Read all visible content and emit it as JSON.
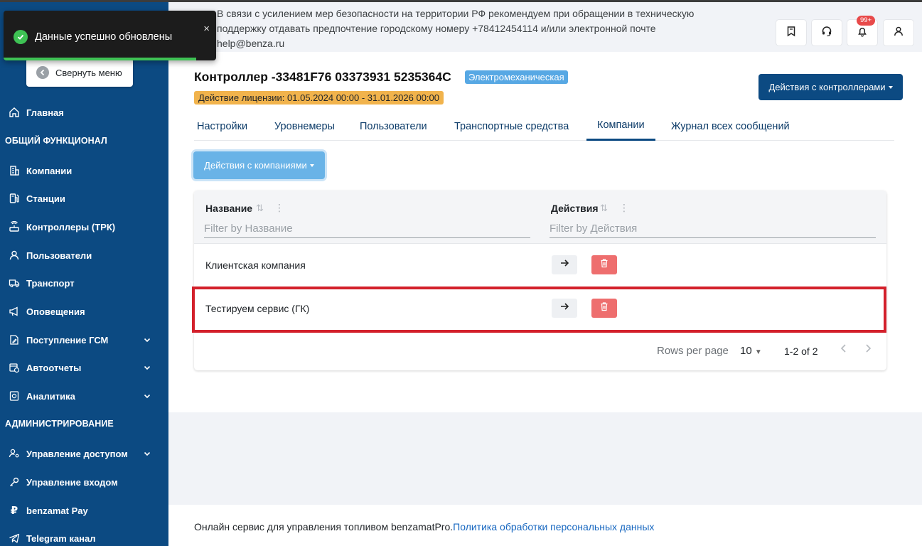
{
  "toast": {
    "message": "Данные успешно обновлены",
    "close": "×"
  },
  "sidebar": {
    "collapse_label": "Свернуть меню",
    "home": "Главная",
    "section_general": "ОБЩИЙ ФУНКЦИОНАЛ",
    "items": [
      "Компании",
      "Станции",
      "Контроллеры (ТРК)",
      "Пользователи",
      "Транспорт",
      "Оповещения",
      "Поступление ГСМ",
      "Автоотчеты",
      "Аналитика"
    ],
    "section_admin": "АДМИНИСТРИРОВАНИЕ",
    "admin_items": [
      "Управление доступом",
      "Управление входом",
      "benzamat Pay",
      "Telegram канал"
    ]
  },
  "header": {
    "notice_line1": "В связи с усилением мер безопасности на территории РФ рекомендуем при обращении в техническую",
    "notice_line2": "поддержку отдавать предпочтение городскому номеру +78412454114 и/или электронной почте",
    "notice_line3": "help@benza.ru",
    "badge": "99+"
  },
  "page": {
    "title": "Контроллер -33481F76 03373931 5235364C",
    "type_badge": "Электромеханическая",
    "license": "Действие лицензии: 01.05.2024 00:00 - 31.01.2026 00:00",
    "actions_button": "Действия с контроллерами"
  },
  "tabs": [
    "Настройки",
    "Уровнемеры",
    "Пользователи",
    "Транспортные средства",
    "Компании",
    "Журнал всех сообщений"
  ],
  "companies_button": "Действия с компаниями",
  "table": {
    "columns": [
      "Название",
      "Действия"
    ],
    "filters": [
      "Filter by Название",
      "Filter by Действия"
    ],
    "rows": [
      "Клиентская компания",
      "Тестируем сервис (ГК)"
    ],
    "rows_per_page_label": "Rows per page",
    "rows_per_page_value": "10",
    "range": "1-2 of 2"
  },
  "footer": {
    "text": "Онлайн сервис для управления топливом benzamatPro.",
    "link": "Политика обработки персональных данных"
  },
  "colors": {
    "sidebar": "#0c4a82",
    "accent": "#69b3e7",
    "danger": "#ee6e6e",
    "license": "#f1b34c",
    "highlight": "#d3202b"
  }
}
